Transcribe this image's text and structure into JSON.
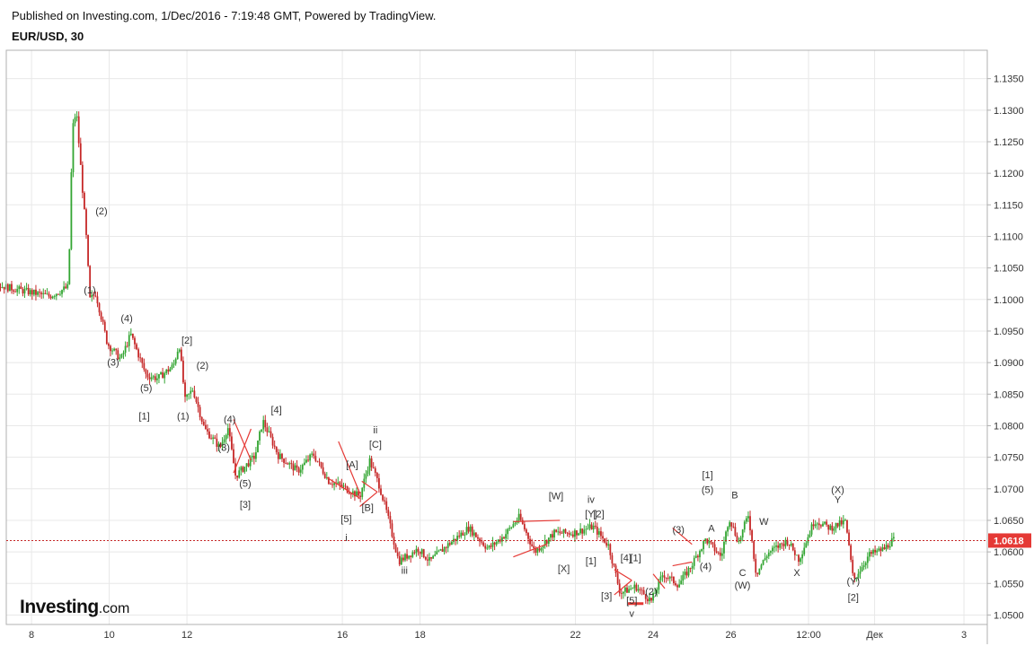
{
  "header": {
    "published": "Published on Investing.com, 1/Dec/2016 - 7:19:48 GMT, Powered by TradingView.",
    "symbol": "EUR/USD, 30"
  },
  "logo": {
    "brand": "Investing",
    "suffix": ".com"
  },
  "colors": {
    "up": "#33a532",
    "down": "#c62828",
    "wave_line": "#e53935",
    "price_line": "#c62828",
    "price_badge": "#e53935",
    "grid": "#e8e8e8",
    "axis_border": "#b0b0b0"
  },
  "chart_data": {
    "type": "candlestick",
    "symbol": "EUR/USD",
    "interval": "30",
    "ylim": [
      1.0485,
      1.1395
    ],
    "y_ticks": [
      "1.0500",
      "1.0550",
      "1.0600",
      "1.0650",
      "1.0700",
      "1.0750",
      "1.0800",
      "1.0850",
      "1.0900",
      "1.0950",
      "1.1000",
      "1.1050",
      "1.1100",
      "1.1150",
      "1.1200",
      "1.1250",
      "1.1300",
      "1.1350"
    ],
    "x_ticks": [
      "8",
      "10",
      "12",
      "16",
      "18",
      "22",
      "24",
      "26",
      "12:00",
      "Дек",
      "3"
    ],
    "last_price": "1.0618",
    "price_path": [
      [
        0,
        1.107
      ],
      [
        2,
        1.104
      ],
      [
        3,
        1.1045
      ],
      [
        5,
        1.106
      ],
      [
        7,
        1.1025
      ],
      [
        8.5,
        1.1005
      ],
      [
        9,
        1.102
      ],
      [
        9.1,
        1.127
      ],
      [
        9.2,
        1.13
      ],
      [
        9.3,
        1.122
      ],
      [
        9.45,
        1.1105
      ],
      [
        9.55,
        1.1
      ],
      [
        9.7,
        1.101
      ],
      [
        10,
        1.093
      ],
      [
        10.35,
        1.0905
      ],
      [
        10.6,
        1.0945
      ],
      [
        11,
        1.088
      ],
      [
        11.3,
        1.0875
      ],
      [
        11.7,
        1.0895
      ],
      [
        11.85,
        1.093
      ],
      [
        12,
        1.084
      ],
      [
        12.2,
        1.0858
      ],
      [
        12.5,
        1.0795
      ],
      [
        12.9,
        1.0765
      ],
      [
        13.1,
        1.0798
      ],
      [
        13.3,
        1.072
      ],
      [
        13.8,
        1.0752
      ],
      [
        14,
        1.0808
      ],
      [
        14.4,
        1.0753
      ],
      [
        14.9,
        1.0728
      ],
      [
        15.3,
        1.0755
      ],
      [
        15.7,
        1.0712
      ],
      [
        16,
        1.0705
      ],
      [
        16.5,
        1.0688
      ],
      [
        16.75,
        1.0745
      ],
      [
        17,
        1.0705
      ],
      [
        17.2,
        1.066
      ],
      [
        17.5,
        1.0585
      ],
      [
        18,
        1.0605
      ],
      [
        18.3,
        1.0585
      ],
      [
        18.7,
        1.0608
      ],
      [
        19.3,
        1.0638
      ],
      [
        19.8,
        1.0605
      ],
      [
        20.2,
        1.0625
      ],
      [
        20.6,
        1.0655
      ],
      [
        21,
        1.06
      ],
      [
        21.5,
        1.063
      ],
      [
        22,
        1.063
      ],
      [
        22.5,
        1.064
      ],
      [
        22.9,
        1.061
      ],
      [
        23.2,
        1.0535
      ],
      [
        23.6,
        1.0545
      ],
      [
        24,
        1.0522
      ],
      [
        24.3,
        1.0565
      ],
      [
        24.7,
        1.0548
      ],
      [
        25,
        1.0575
      ],
      [
        25.4,
        1.062
      ],
      [
        25.8,
        1.0592
      ],
      [
        26,
        1.0655
      ],
      [
        26.25,
        1.0615
      ],
      [
        26.5,
        1.066
      ],
      [
        26.7,
        1.0565
      ],
      [
        27,
        1.0598
      ],
      [
        27.5,
        1.0618
      ],
      [
        27.8,
        1.0588
      ],
      [
        28.2,
        1.065
      ],
      [
        28.6,
        1.0638
      ],
      [
        29,
        1.0648
      ],
      [
        29.2,
        1.0555
      ],
      [
        29.6,
        1.0595
      ],
      [
        30,
        1.0605
      ],
      [
        30.2,
        1.0618
      ]
    ],
    "wave_labels": [
      {
        "text": "(2)",
        "t": 9.8,
        "p": 1.1135
      },
      {
        "text": "(1)",
        "t": 9.5,
        "p": 1.101
      },
      {
        "text": "(4)",
        "t": 10.45,
        "p": 1.0965
      },
      {
        "text": "(3)",
        "t": 10.1,
        "p": 1.0895
      },
      {
        "text": "(5)",
        "t": 10.95,
        "p": 1.0855
      },
      {
        "text": "[1]",
        "t": 10.9,
        "p": 1.081
      },
      {
        "text": "[2]",
        "t": 12.0,
        "p": 1.093
      },
      {
        "text": "(2)",
        "t": 12.4,
        "p": 1.089
      },
      {
        "text": "(1)",
        "t": 11.9,
        "p": 1.081
      },
      {
        "text": "(4)",
        "t": 13.1,
        "p": 1.0805
      },
      {
        "text": "(3)",
        "t": 12.95,
        "p": 1.076
      },
      {
        "text": "(5)",
        "t": 13.5,
        "p": 1.0703
      },
      {
        "text": "[3]",
        "t": 13.5,
        "p": 1.067
      },
      {
        "text": "[4]",
        "t": 14.3,
        "p": 1.082
      },
      {
        "text": "ii",
        "t": 16.85,
        "p": 1.0788
      },
      {
        "text": "[C]",
        "t": 16.85,
        "p": 1.0765
      },
      {
        "text": "[A]",
        "t": 16.25,
        "p": 1.0733
      },
      {
        "text": "[B]",
        "t": 16.65,
        "p": 1.0665
      },
      {
        "text": "[5]",
        "t": 16.1,
        "p": 1.0647
      },
      {
        "text": "i",
        "t": 16.1,
        "p": 1.0617
      },
      {
        "text": "iii",
        "t": 17.6,
        "p": 1.0565
      },
      {
        "text": "[W]",
        "t": 21.5,
        "p": 1.0683
      },
      {
        "text": "[X]",
        "t": 21.7,
        "p": 1.0568
      },
      {
        "text": "iv",
        "t": 22.4,
        "p": 1.0678
      },
      {
        "text": "[Y]",
        "t": 22.4,
        "p": 1.0655
      },
      {
        "text": "[2]",
        "t": 22.6,
        "p": 1.0655
      },
      {
        "text": "[1]",
        "t": 22.4,
        "p": 1.058
      },
      {
        "text": "[3]",
        "t": 22.8,
        "p": 1.0525
      },
      {
        "text": "[4]",
        "t": 23.3,
        "p": 1.0585
      },
      {
        "text": "[1]",
        "t": 23.55,
        "p": 1.0585
      },
      {
        "text": "[5]",
        "t": 23.45,
        "p": 1.0518
      },
      {
        "text": "v",
        "t": 23.45,
        "p": 1.0497
      },
      {
        "text": "(2)",
        "t": 23.95,
        "p": 1.0532
      },
      {
        "text": "(3)",
        "t": 24.65,
        "p": 1.063
      },
      {
        "text": "(4)",
        "t": 25.35,
        "p": 1.0572
      },
      {
        "text": "[1]",
        "t": 25.4,
        "p": 1.0717
      },
      {
        "text": "(5)",
        "t": 25.4,
        "p": 1.0693
      },
      {
        "text": "A",
        "t": 25.5,
        "p": 1.0632
      },
      {
        "text": "B",
        "t": 26.1,
        "p": 1.0685
      },
      {
        "text": "C",
        "t": 26.3,
        "p": 1.0562
      },
      {
        "text": "(W)",
        "t": 26.3,
        "p": 1.0542
      },
      {
        "text": "W",
        "t": 26.85,
        "p": 1.0643
      },
      {
        "text": "X",
        "t": 27.7,
        "p": 1.0562
      },
      {
        "text": "(X)",
        "t": 28.75,
        "p": 1.0693
      },
      {
        "text": "Y",
        "t": 28.75,
        "p": 1.0678
      },
      {
        "text": "(Y)",
        "t": 29.15,
        "p": 1.0548
      },
      {
        "text": "[2]",
        "t": 29.15,
        "p": 1.0523
      }
    ],
    "wave_lines": [
      [
        [
          13.2,
          1.081
        ],
        [
          13.65,
          1.0745
        ]
      ],
      [
        [
          13.2,
          1.0725
        ],
        [
          13.65,
          1.0795
        ]
      ],
      [
        [
          15.6,
          1.0718
        ],
        [
          16.45,
          1.0685
        ]
      ],
      [
        [
          15.9,
          1.0775
        ],
        [
          16.45,
          1.0693
        ]
      ],
      [
        [
          16.45,
          1.0672
        ],
        [
          16.9,
          1.0695
        ]
      ],
      [
        [
          16.5,
          1.0712
        ],
        [
          16.9,
          1.0695
        ]
      ],
      [
        [
          20.4,
          1.0648
        ],
        [
          21.6,
          1.065
        ]
      ],
      [
        [
          20.4,
          1.0592
        ],
        [
          21.25,
          1.0612
        ]
      ],
      [
        [
          23.0,
          1.0572
        ],
        [
          23.45,
          1.0555
        ]
      ],
      [
        [
          23.0,
          1.0532
        ],
        [
          23.45,
          1.0555
        ]
      ],
      [
        [
          24.0,
          1.0565
        ],
        [
          24.3,
          1.0542
        ]
      ],
      [
        [
          24.5,
          1.0638
        ],
        [
          25.0,
          1.0612
        ]
      ],
      [
        [
          24.5,
          1.0578
        ],
        [
          25.0,
          1.0584
        ]
      ]
    ],
    "highlight_bar": [
      [
        23.35,
        1.0518
      ],
      [
        23.75,
        1.0518
      ]
    ]
  }
}
